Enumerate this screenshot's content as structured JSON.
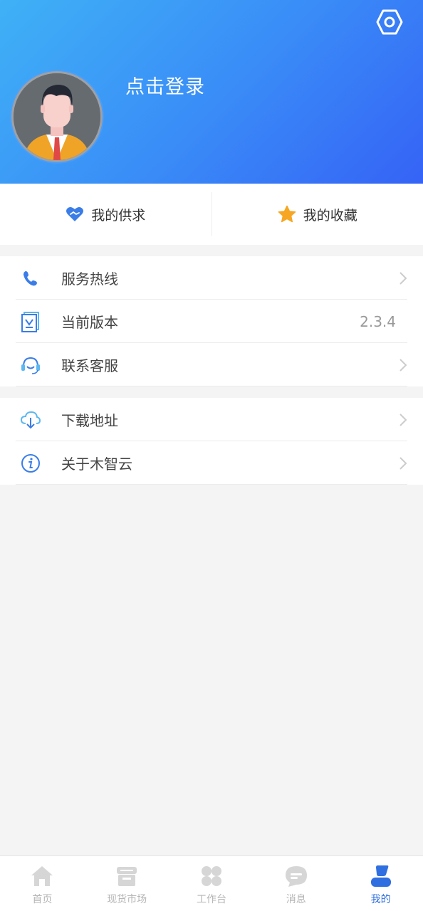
{
  "header": {
    "login_text": "点击登录",
    "gradient_colors": [
      "#3fb1f6",
      "#3563f6"
    ]
  },
  "quick_actions": [
    {
      "label": "我的供求",
      "icon": "handshake-heart-icon"
    },
    {
      "label": "我的收藏",
      "icon": "star-icon"
    }
  ],
  "menu_group_1": [
    {
      "label": "服务热线",
      "icon": "phone-icon",
      "value": ""
    },
    {
      "label": "当前版本",
      "icon": "version-icon",
      "value": "2.3.4"
    },
    {
      "label": "联系客服",
      "icon": "headset-icon",
      "value": ""
    }
  ],
  "menu_group_2": [
    {
      "label": "下载地址",
      "icon": "cloud-download-icon",
      "value": ""
    },
    {
      "label": "关于木智云",
      "icon": "info-icon",
      "value": ""
    }
  ],
  "tabbar": [
    {
      "label": "首页",
      "icon": "home-icon",
      "active": false
    },
    {
      "label": "现货市场",
      "icon": "market-icon",
      "active": false
    },
    {
      "label": "工作台",
      "icon": "workbench-icon",
      "active": false
    },
    {
      "label": "消息",
      "icon": "message-icon",
      "active": false
    },
    {
      "label": "我的",
      "icon": "profile-icon",
      "active": true
    }
  ],
  "colors": {
    "accent": "#2f6fe0",
    "icon_blue": "#3a7de8",
    "star": "#f6a623",
    "inactive_tab": "#d0d0d0"
  }
}
